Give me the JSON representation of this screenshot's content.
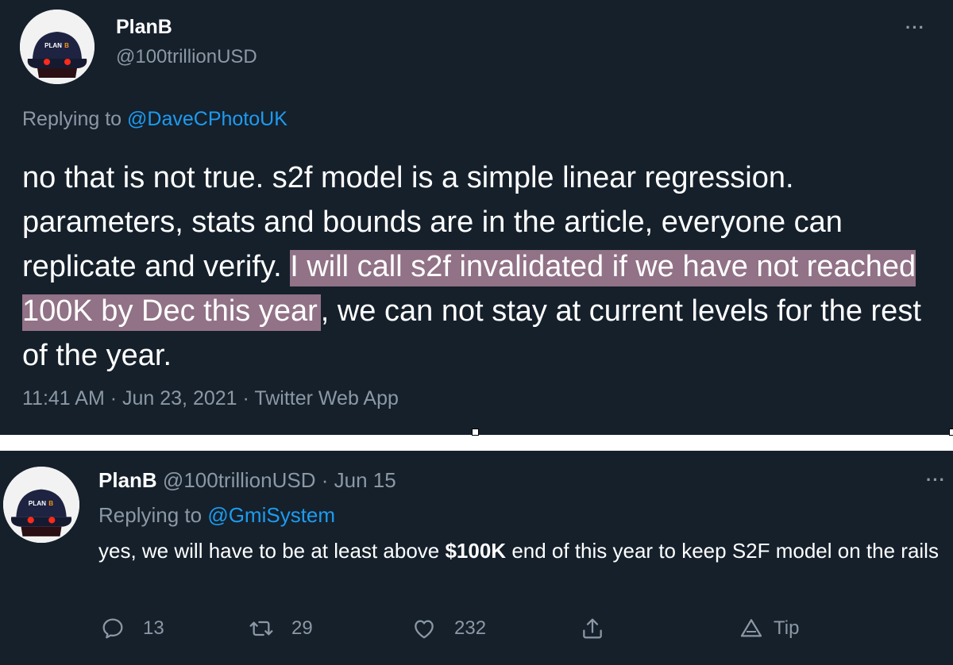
{
  "tweet1": {
    "display_name": "PlanB",
    "handle": "@100trillionUSD",
    "reply_prefix": "Replying to ",
    "reply_to": "@DaveCPhotoUK",
    "text_before": "no that is not true. s2f model is a simple linear regression. parameters, stats and bounds are in the article, everyone can replicate and verify. ",
    "text_highlight": "I will call s2f invalidated if we have not reached 100K by Dec this year",
    "text_after": ", we can not stay at current levels for the rest of the year.",
    "time": "11:41 AM",
    "date": "Jun 23, 2021",
    "source": "Twitter Web App",
    "separator": " · ",
    "more": "···"
  },
  "tweet2": {
    "display_name": "PlanB",
    "handle": "@100trillionUSD",
    "separator": " · ",
    "date": "Jun 15",
    "reply_prefix": "Replying to ",
    "reply_to": "@GmiSystem",
    "text_before": "yes, we will have to be at least above ",
    "text_bold": "$100K",
    "text_after": " end of this year to keep S2F model on the rails",
    "more": "···",
    "actions": {
      "replies": "13",
      "retweets": "29",
      "likes": "232",
      "tip_label": "Tip"
    }
  },
  "avatar": {
    "cap_text": "PLAN",
    "cap_mark": "B"
  },
  "colors": {
    "background": "#15202b",
    "secondary_text": "#8b98a5",
    "link": "#1d9bf0",
    "highlight": "#917286"
  }
}
